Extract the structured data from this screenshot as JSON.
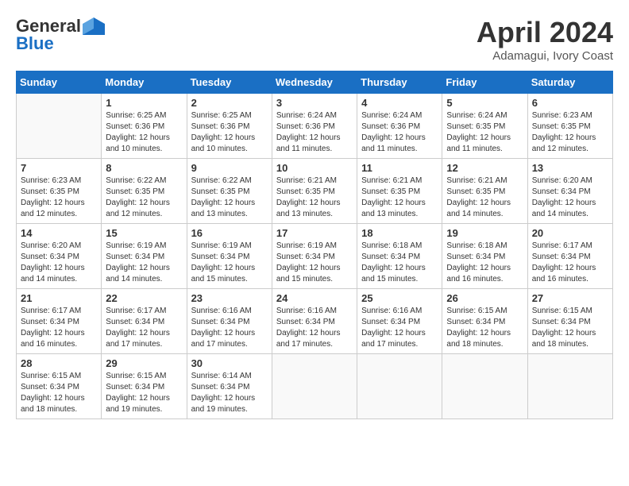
{
  "logo": {
    "general": "General",
    "blue": "Blue"
  },
  "title": "April 2024",
  "subtitle": "Adamagui, Ivory Coast",
  "days": [
    "Sunday",
    "Monday",
    "Tuesday",
    "Wednesday",
    "Thursday",
    "Friday",
    "Saturday"
  ],
  "weeks": [
    [
      {
        "day": "",
        "sunrise": "",
        "sunset": "",
        "daylight": ""
      },
      {
        "day": "1",
        "sunrise": "Sunrise: 6:25 AM",
        "sunset": "Sunset: 6:36 PM",
        "daylight": "Daylight: 12 hours and 10 minutes."
      },
      {
        "day": "2",
        "sunrise": "Sunrise: 6:25 AM",
        "sunset": "Sunset: 6:36 PM",
        "daylight": "Daylight: 12 hours and 10 minutes."
      },
      {
        "day": "3",
        "sunrise": "Sunrise: 6:24 AM",
        "sunset": "Sunset: 6:36 PM",
        "daylight": "Daylight: 12 hours and 11 minutes."
      },
      {
        "day": "4",
        "sunrise": "Sunrise: 6:24 AM",
        "sunset": "Sunset: 6:36 PM",
        "daylight": "Daylight: 12 hours and 11 minutes."
      },
      {
        "day": "5",
        "sunrise": "Sunrise: 6:24 AM",
        "sunset": "Sunset: 6:35 PM",
        "daylight": "Daylight: 12 hours and 11 minutes."
      },
      {
        "day": "6",
        "sunrise": "Sunrise: 6:23 AM",
        "sunset": "Sunset: 6:35 PM",
        "daylight": "Daylight: 12 hours and 12 minutes."
      }
    ],
    [
      {
        "day": "7",
        "sunrise": "Sunrise: 6:23 AM",
        "sunset": "Sunset: 6:35 PM",
        "daylight": "Daylight: 12 hours and 12 minutes."
      },
      {
        "day": "8",
        "sunrise": "Sunrise: 6:22 AM",
        "sunset": "Sunset: 6:35 PM",
        "daylight": "Daylight: 12 hours and 12 minutes."
      },
      {
        "day": "9",
        "sunrise": "Sunrise: 6:22 AM",
        "sunset": "Sunset: 6:35 PM",
        "daylight": "Daylight: 12 hours and 13 minutes."
      },
      {
        "day": "10",
        "sunrise": "Sunrise: 6:21 AM",
        "sunset": "Sunset: 6:35 PM",
        "daylight": "Daylight: 12 hours and 13 minutes."
      },
      {
        "day": "11",
        "sunrise": "Sunrise: 6:21 AM",
        "sunset": "Sunset: 6:35 PM",
        "daylight": "Daylight: 12 hours and 13 minutes."
      },
      {
        "day": "12",
        "sunrise": "Sunrise: 6:21 AM",
        "sunset": "Sunset: 6:35 PM",
        "daylight": "Daylight: 12 hours and 14 minutes."
      },
      {
        "day": "13",
        "sunrise": "Sunrise: 6:20 AM",
        "sunset": "Sunset: 6:34 PM",
        "daylight": "Daylight: 12 hours and 14 minutes."
      }
    ],
    [
      {
        "day": "14",
        "sunrise": "Sunrise: 6:20 AM",
        "sunset": "Sunset: 6:34 PM",
        "daylight": "Daylight: 12 hours and 14 minutes."
      },
      {
        "day": "15",
        "sunrise": "Sunrise: 6:19 AM",
        "sunset": "Sunset: 6:34 PM",
        "daylight": "Daylight: 12 hours and 14 minutes."
      },
      {
        "day": "16",
        "sunrise": "Sunrise: 6:19 AM",
        "sunset": "Sunset: 6:34 PM",
        "daylight": "Daylight: 12 hours and 15 minutes."
      },
      {
        "day": "17",
        "sunrise": "Sunrise: 6:19 AM",
        "sunset": "Sunset: 6:34 PM",
        "daylight": "Daylight: 12 hours and 15 minutes."
      },
      {
        "day": "18",
        "sunrise": "Sunrise: 6:18 AM",
        "sunset": "Sunset: 6:34 PM",
        "daylight": "Daylight: 12 hours and 15 minutes."
      },
      {
        "day": "19",
        "sunrise": "Sunrise: 6:18 AM",
        "sunset": "Sunset: 6:34 PM",
        "daylight": "Daylight: 12 hours and 16 minutes."
      },
      {
        "day": "20",
        "sunrise": "Sunrise: 6:17 AM",
        "sunset": "Sunset: 6:34 PM",
        "daylight": "Daylight: 12 hours and 16 minutes."
      }
    ],
    [
      {
        "day": "21",
        "sunrise": "Sunrise: 6:17 AM",
        "sunset": "Sunset: 6:34 PM",
        "daylight": "Daylight: 12 hours and 16 minutes."
      },
      {
        "day": "22",
        "sunrise": "Sunrise: 6:17 AM",
        "sunset": "Sunset: 6:34 PM",
        "daylight": "Daylight: 12 hours and 17 minutes."
      },
      {
        "day": "23",
        "sunrise": "Sunrise: 6:16 AM",
        "sunset": "Sunset: 6:34 PM",
        "daylight": "Daylight: 12 hours and 17 minutes."
      },
      {
        "day": "24",
        "sunrise": "Sunrise: 6:16 AM",
        "sunset": "Sunset: 6:34 PM",
        "daylight": "Daylight: 12 hours and 17 minutes."
      },
      {
        "day": "25",
        "sunrise": "Sunrise: 6:16 AM",
        "sunset": "Sunset: 6:34 PM",
        "daylight": "Daylight: 12 hours and 17 minutes."
      },
      {
        "day": "26",
        "sunrise": "Sunrise: 6:15 AM",
        "sunset": "Sunset: 6:34 PM",
        "daylight": "Daylight: 12 hours and 18 minutes."
      },
      {
        "day": "27",
        "sunrise": "Sunrise: 6:15 AM",
        "sunset": "Sunset: 6:34 PM",
        "daylight": "Daylight: 12 hours and 18 minutes."
      }
    ],
    [
      {
        "day": "28",
        "sunrise": "Sunrise: 6:15 AM",
        "sunset": "Sunset: 6:34 PM",
        "daylight": "Daylight: 12 hours and 18 minutes."
      },
      {
        "day": "29",
        "sunrise": "Sunrise: 6:15 AM",
        "sunset": "Sunset: 6:34 PM",
        "daylight": "Daylight: 12 hours and 19 minutes."
      },
      {
        "day": "30",
        "sunrise": "Sunrise: 6:14 AM",
        "sunset": "Sunset: 6:34 PM",
        "daylight": "Daylight: 12 hours and 19 minutes."
      },
      {
        "day": "",
        "sunrise": "",
        "sunset": "",
        "daylight": ""
      },
      {
        "day": "",
        "sunrise": "",
        "sunset": "",
        "daylight": ""
      },
      {
        "day": "",
        "sunrise": "",
        "sunset": "",
        "daylight": ""
      },
      {
        "day": "",
        "sunrise": "",
        "sunset": "",
        "daylight": ""
      }
    ]
  ]
}
